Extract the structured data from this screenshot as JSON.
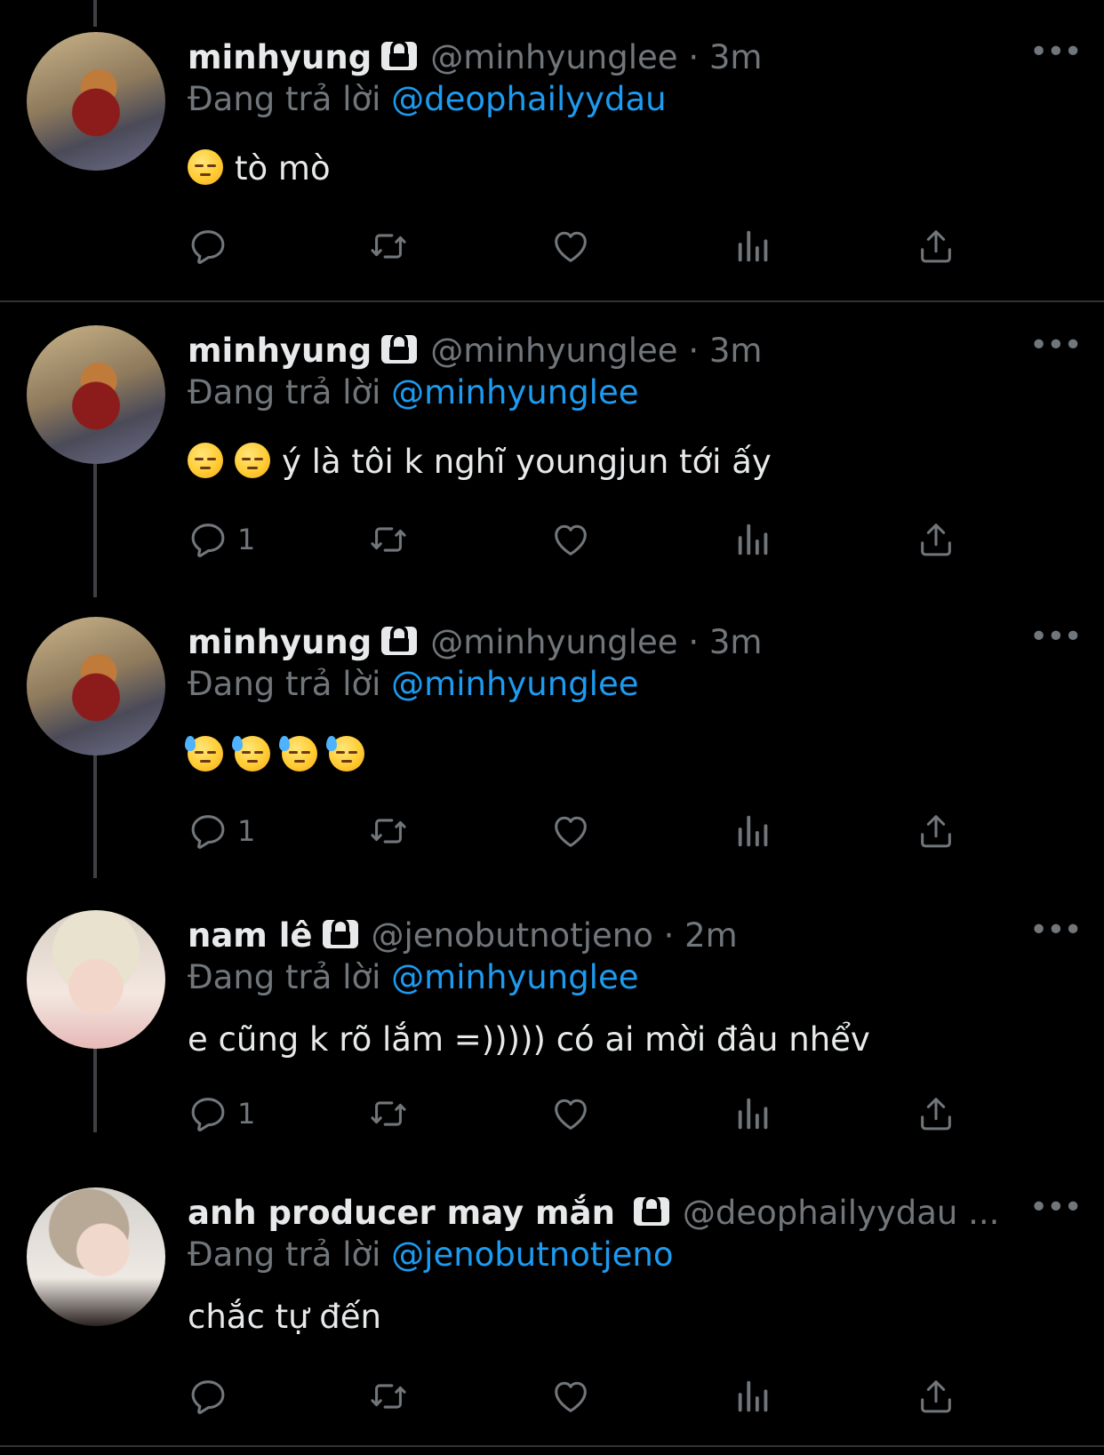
{
  "tweets": [
    {
      "name": "minhyung",
      "handle": "@minhyunglee",
      "time": "· 3m",
      "reply_prefix": "Đang trả lời",
      "reply_to": "@deophailyydau",
      "emojis": [
        "pensive"
      ],
      "text": "tò mò",
      "reply_count": "",
      "avatar": "bear-avatar"
    },
    {
      "name": "minhyung",
      "handle": "@minhyunglee",
      "time": "· 3m",
      "reply_prefix": "Đang trả lời",
      "reply_to": "@minhyunglee",
      "emojis": [
        "pensive",
        "pensive"
      ],
      "text": "ý là tôi k nghĩ youngjun tới ấy",
      "reply_count": "1",
      "avatar": "bear-avatar"
    },
    {
      "name": "minhyung",
      "handle": "@minhyunglee",
      "time": "· 3m",
      "reply_prefix": "Đang trả lời",
      "reply_to": "@minhyunglee",
      "emojis": [
        "downcast-sweat",
        "downcast-sweat",
        "downcast-sweat",
        "downcast-sweat"
      ],
      "text": "",
      "reply_count": "1",
      "avatar": "bear-avatar"
    },
    {
      "name": "nam lê",
      "handle": "@jenobutnotjeno",
      "time": "· 2m",
      "reply_prefix": "Đang trả lời",
      "reply_to": "@minhyunglee",
      "emojis": [],
      "text": "e cũng k rõ lắm =))))) có ai mời đâu nhểv",
      "reply_count": "1",
      "avatar": "blonde-avatar"
    },
    {
      "name": "anh producer may mắn",
      "handle": "@deophailyydau ...",
      "time": "",
      "reply_prefix": "Đang trả lời",
      "reply_to": "@jenobutnotjeno",
      "emojis": [],
      "text": "chắc tự đến",
      "reply_count": "",
      "avatar": "selfie-avatar"
    }
  ],
  "more_label": "•••",
  "icons": [
    "reply-icon",
    "retweet-icon",
    "like-icon",
    "views-icon",
    "share-icon",
    "lock-icon",
    "more-icon"
  ],
  "colors": {
    "background": "#000000",
    "text": "#e7e9ea",
    "muted": "#71767b",
    "mention": "#1d9bf0",
    "divider": "#2f3336"
  }
}
